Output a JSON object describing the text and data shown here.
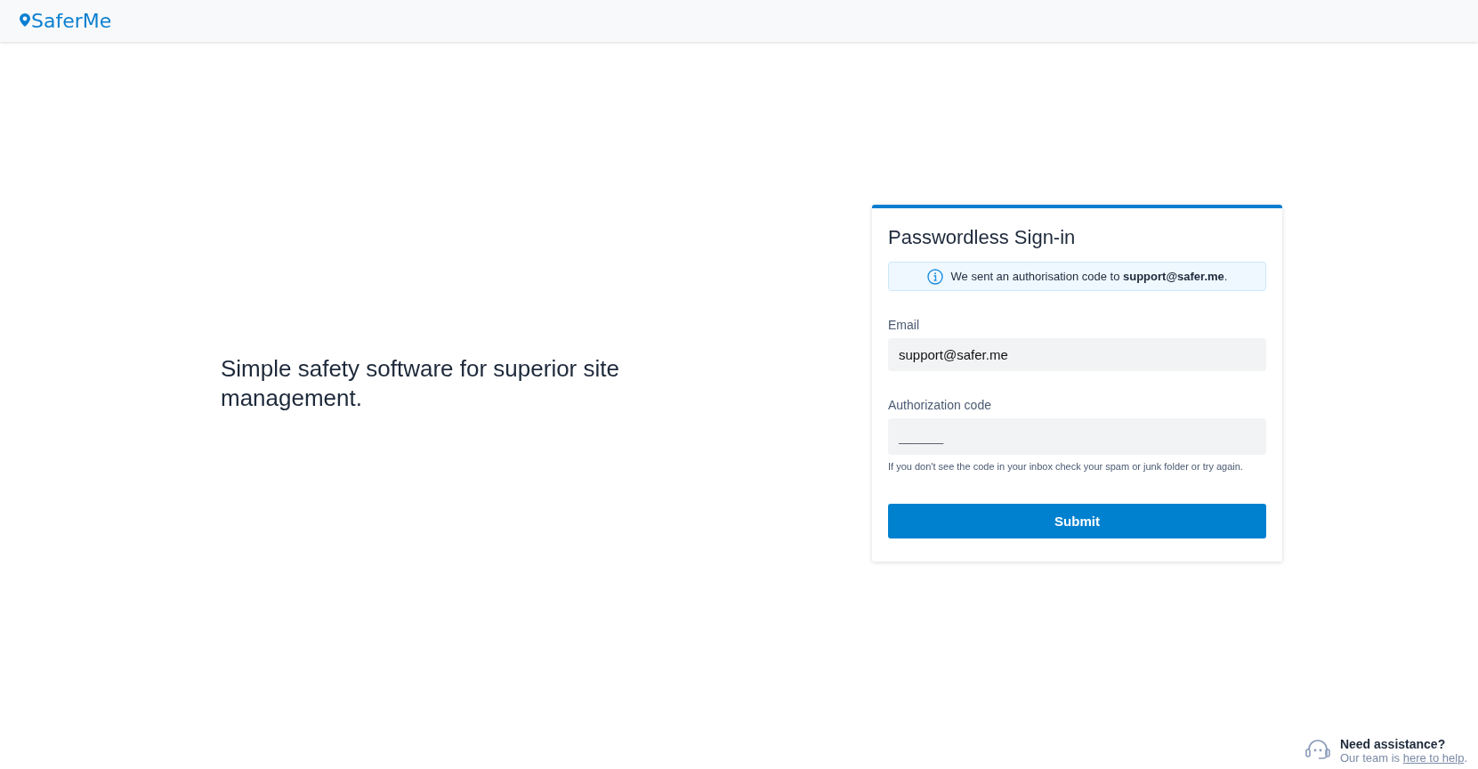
{
  "header": {
    "logo": "SaferMe"
  },
  "tagline": "Simple safety software for superior site management.",
  "card": {
    "title": "Passwordless Sign-in",
    "notice": "We sent an authorisation code to **support@safer.me**.",
    "fields": [
      {
        "label": "Email",
        "value": "support@safer.me"
      },
      {
        "label": "Authorization code",
        "placeholder": "______",
        "hint": "If you don't see the code in your inbox check your spam or junk folder or try again."
      }
    ],
    "submit": "Submit"
  },
  "help": {
    "title": "Need assistance?",
    "text_before": "Our team is ",
    "link": "here to help",
    "text_after": "."
  }
}
